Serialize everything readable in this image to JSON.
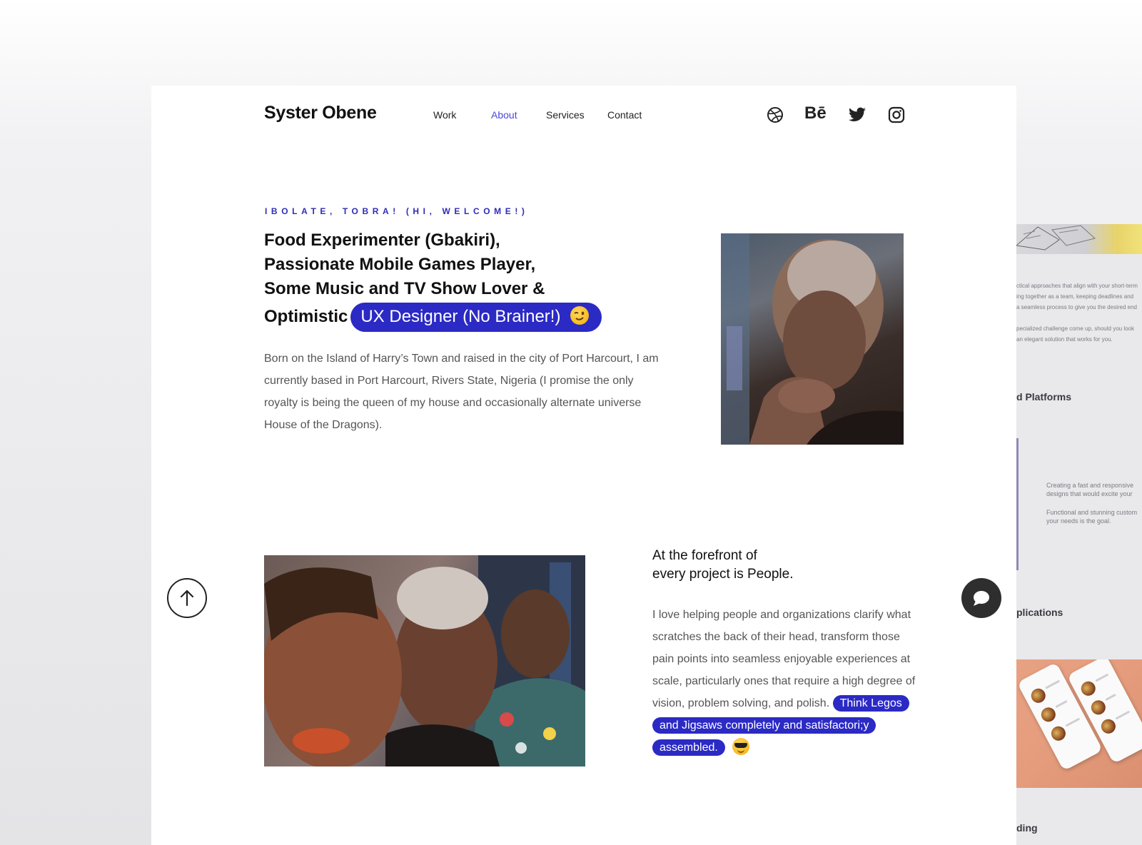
{
  "header": {
    "logo": "Syster Obene",
    "nav": [
      {
        "label": "Work"
      },
      {
        "label": "About"
      },
      {
        "label": "Services"
      },
      {
        "label": "Contact"
      }
    ],
    "social": [
      "dribbble-icon",
      "behance-icon",
      "twitter-icon",
      "instagram-icon"
    ],
    "social_behance_text": "Bē"
  },
  "hero": {
    "kicker": "IBOLATE, TOBRA! (HI, WELCOME!)",
    "headline_lines": [
      "Food Experimenter (Gbakiri),",
      "Passionate Mobile Games Player,",
      "Some Music and TV Show Lover &",
      "Optimistic"
    ],
    "highlight": "UX Designer (No Brainer!)",
    "bio": "Born on the Island of Harry’s Town and raised in the city of Port Harcourt, I am currently based in Port Harcourt, Rivers State, Nigeria (I promise the only royalty is being the queen of my house and occasionally alternate universe House of the Dragons)."
  },
  "people": {
    "title_line1": "At the forefront of",
    "title_line2": "every project is People.",
    "body": "I love helping people and organizations clarify what scratches the back of their head, transform those pain points into seamless enjoyable experiences at scale, particularly ones that require a high degree of vision, problem solving, and polish.",
    "highlight": "Think Legos and Jigsaws completely and satisfactori;y assembled."
  },
  "peek": {
    "texts": [
      "ctical approaches that align with your short-term",
      "ing together as a team, keeping deadlines and",
      "a seamless process to give you the desired end",
      "pecialized challenge come up, should you look",
      "an elegant solution that works for you."
    ],
    "heading1": "d Platforms",
    "desc": [
      "Creating a fast and responsive",
      "designs that would excite your",
      "Functional and stunning custom",
      "your needs is the goal."
    ],
    "heading2": "plications",
    "heading3": "ding"
  },
  "colors": {
    "accent": "#2b2ac4",
    "nav_active": "#4a48d6",
    "text_dark": "#111111",
    "text_body": "#555555"
  }
}
